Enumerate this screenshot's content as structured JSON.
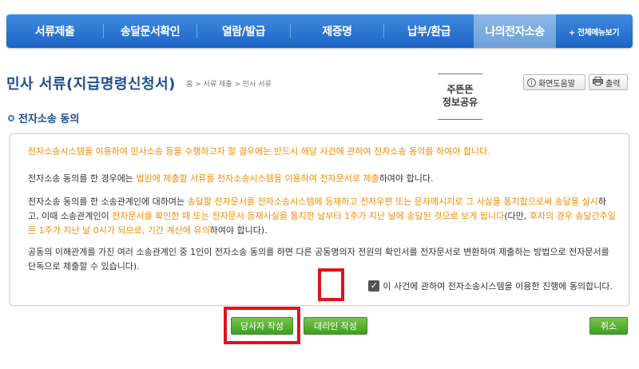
{
  "nav": {
    "items": [
      {
        "label": "서류제출"
      },
      {
        "label": "송달문서확인"
      },
      {
        "label": "열람/발급"
      },
      {
        "label": "제증명"
      },
      {
        "label": "납부/환급"
      },
      {
        "label": "나의전자소송"
      }
    ],
    "all_menu": "+ 전체메뉴보기"
  },
  "page": {
    "title": "민사 서류(지급명령신청서)",
    "breadcrumb": "홈 > 서류 제출 > 민사 서류",
    "share_line1": "주뜬뜬",
    "share_line2": "정보공유",
    "help_label": "화면도움말",
    "print_label": "출력"
  },
  "section": {
    "title": "전자소송 동의"
  },
  "consent": {
    "p1": "전자소송시스템을 이용하여 민사소송 등을 수행하고자 할 경우에는 반드시 해당 사건에 관하여 전자소송 동의를 하여야 합니다.",
    "p2_a": "전자소송 동의를 한 경우에는 ",
    "p2_b": "법원에 제출할 서류를 전자소송시스템을 이용하여 전자문서로 제출",
    "p2_c": "하여야 합니다.",
    "p3_a": "전자소송 동의를 한 소송관계인에 대하여는 ",
    "p3_b": "송달할 전자문서를 전자소송시스템에 등재하고 전자우편 또는 문자메시지로 그 사실을 통지합으로써 송달을 실시",
    "p3_c": "하고, 이때 소송관계인이 ",
    "p3_d": "전자문서를 확인한 때 또는 전자문서 등재사실을 통지한 날부터 1주가 지난 날에 송달된 것으로 보게 됩니다",
    "p3_e": "(다만, ",
    "p3_f": "후자의 경우 송달간주일은 1주가 지난 날 0시가 되므로, 기간 계산에 유의",
    "p3_g": "하여야 합니다).",
    "p4": "공동의 이해관계를 가진 여러 소송관계인 중 1인이 전자소송 동의를 하면 다른 공동명의자 전원의 확인서를 전자문서로 변환하여 제출하는 방법으로 전자문서를 단독으로 제출할 수 있습니다).",
    "agree_label": "이 사건에 관하여 전자소송시스템을 이용한 진행에 동의합니다.",
    "agree_checked": true
  },
  "buttons": {
    "party": "당사자 작성",
    "agent": "대리인 작성",
    "cancel": "취소"
  },
  "colors": {
    "nav": "#1d63c4",
    "accent_orange": "#f08c00",
    "highlight": "#e0131b",
    "green": "#4aa82c"
  }
}
